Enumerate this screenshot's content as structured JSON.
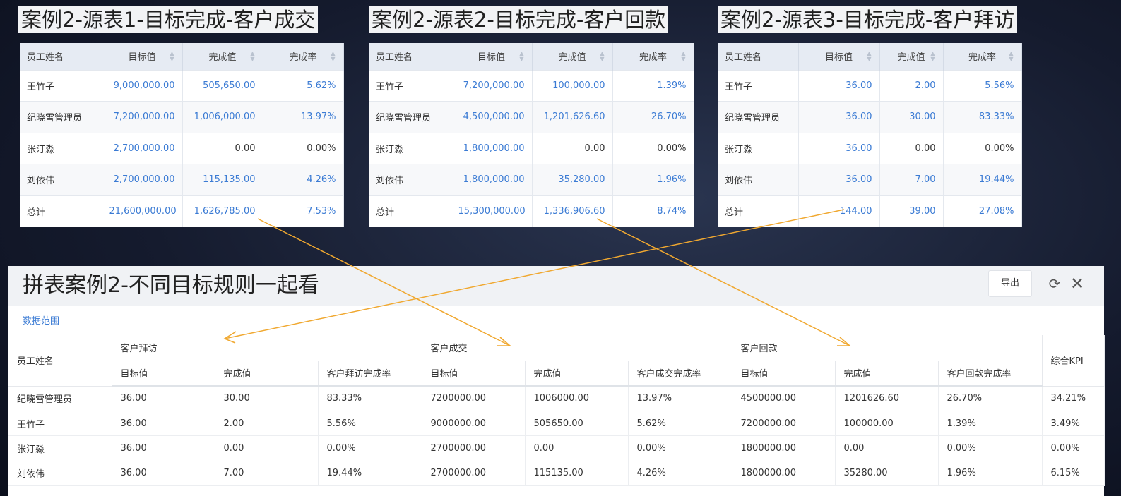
{
  "source_tables": [
    {
      "title": "案例2-源表1-目标完成-客户成交",
      "headers": [
        "员工姓名",
        "目标值",
        "完成值",
        "完成率"
      ],
      "rows": [
        [
          "王竹子",
          "9,000,000.00",
          "505,650.00",
          "5.62%"
        ],
        [
          "纪晓雪管理员",
          "7,200,000.00",
          "1,006,000.00",
          "13.97%"
        ],
        [
          "张汀淼",
          "2,700,000.00",
          "0.00",
          "0.00%"
        ],
        [
          "刘依伟",
          "2,700,000.00",
          "115,135.00",
          "4.26%"
        ],
        [
          "总计",
          "21,600,000.00",
          "1,626,785.00",
          "7.53%"
        ]
      ]
    },
    {
      "title": "案例2-源表2-目标完成-客户回款",
      "headers": [
        "员工姓名",
        "目标值",
        "完成值",
        "完成率"
      ],
      "rows": [
        [
          "王竹子",
          "7,200,000.00",
          "100,000.00",
          "1.39%"
        ],
        [
          "纪晓雪管理员",
          "4,500,000.00",
          "1,201,626.60",
          "26.70%"
        ],
        [
          "张汀淼",
          "1,800,000.00",
          "0.00",
          "0.00%"
        ],
        [
          "刘依伟",
          "1,800,000.00",
          "35,280.00",
          "1.96%"
        ],
        [
          "总计",
          "15,300,000.00",
          "1,336,906.60",
          "8.74%"
        ]
      ]
    },
    {
      "title": "案例2-源表3-目标完成-客户拜访",
      "headers": [
        "员工姓名",
        "目标值",
        "完成值",
        "完成率"
      ],
      "rows": [
        [
          "王竹子",
          "36.00",
          "2.00",
          "5.56%"
        ],
        [
          "纪晓雪管理员",
          "36.00",
          "30.00",
          "83.33%"
        ],
        [
          "张汀淼",
          "36.00",
          "0.00",
          "0.00%"
        ],
        [
          "刘依伟",
          "36.00",
          "7.00",
          "19.44%"
        ],
        [
          "总计",
          "144.00",
          "39.00",
          "27.08%"
        ]
      ]
    }
  ],
  "main": {
    "title": "拼表案例2-不同目标规则一起看",
    "export_label": "导出",
    "data_range_label": "数据范围",
    "name_header": "员工姓名",
    "kpi_header": "综合KPI",
    "groups": [
      {
        "label": "客户拜访",
        "subheaders": [
          "目标值",
          "完成值",
          "客户拜访完成率"
        ]
      },
      {
        "label": "客户成交",
        "subheaders": [
          "目标值",
          "完成值",
          "客户成交完成率"
        ]
      },
      {
        "label": "客户回款",
        "subheaders": [
          "目标值",
          "完成值",
          "客户回款完成率"
        ]
      }
    ],
    "rows": [
      [
        "纪晓雪管理员",
        "36.00",
        "30.00",
        "83.33%",
        "7200000.00",
        "1006000.00",
        "13.97%",
        "4500000.00",
        "1201626.60",
        "26.70%",
        "34.21%"
      ],
      [
        "王竹子",
        "36.00",
        "2.00",
        "5.56%",
        "9000000.00",
        "505650.00",
        "5.62%",
        "7200000.00",
        "100000.00",
        "1.39%",
        "3.49%"
      ],
      [
        "张汀淼",
        "36.00",
        "0.00",
        "0.00%",
        "2700000.00",
        "0.00",
        "0.00%",
        "1800000.00",
        "0.00",
        "0.00%",
        "0.00%"
      ],
      [
        "刘依伟",
        "36.00",
        "7.00",
        "19.44%",
        "2700000.00",
        "115135.00",
        "4.26%",
        "1800000.00",
        "35280.00",
        "1.96%",
        "6.15%"
      ]
    ]
  },
  "icons": {
    "sort": "sort-icon",
    "refresh": "refresh-icon",
    "close": "close-icon"
  },
  "colors": {
    "link_blue": "#3b7bd4",
    "arrow_orange": "#f0a830",
    "header_bg": "#e6ebf3"
  }
}
